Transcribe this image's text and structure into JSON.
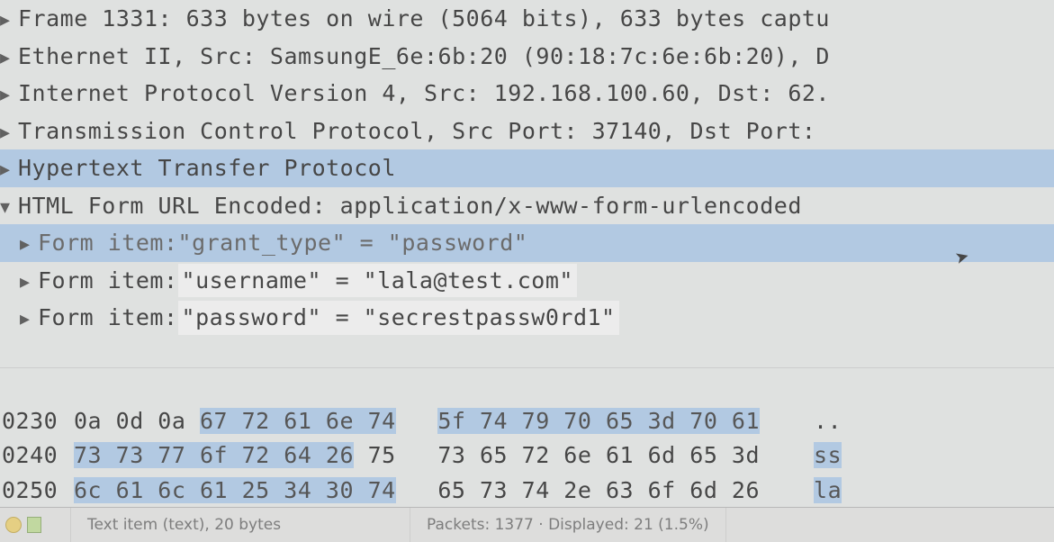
{
  "tree": {
    "frame": "Frame 1331: 633 bytes on wire (5064 bits), 633 bytes captu",
    "ethernet": "Ethernet II, Src: SamsungE_6e:6b:20 (90:18:7c:6e:6b:20), D",
    "ip": "Internet Protocol Version 4, Src: 192.168.100.60, Dst: 62.",
    "tcp": "Transmission Control Protocol, Src Port: 37140, Dst Port: ",
    "http": "Hypertext Transfer Protocol",
    "urlencoded": "HTML Form URL Encoded: application/x-www-form-urlencoded",
    "form_grant_prefix": "Form item: ",
    "form_grant_body": "\"grant_type\" = \"password\"",
    "form_user_prefix": "Form item: ",
    "form_user_body": "\"username\" = \"lala@test.com\"",
    "form_pw_prefix": "Form item: ",
    "form_pw_body": "\"password\" = \"secrestpassw0rd1\""
  },
  "hex": {
    "rows": [
      {
        "offset": "0230",
        "left_plain": "0a 0d 0a ",
        "left_sel": "67 72 61 6e 74",
        "gap": "   ",
        "right_sel": "5f 74 79 70 65 3d 70 61",
        "right_plain": "",
        "ascii": "..",
        "ascii_sel": ""
      },
      {
        "offset": "0240",
        "left_plain": "",
        "left_sel": "73 73 77 6f 72 64 26",
        "gap": " ",
        "right_sel": "",
        "right_plain": "75   73 65 72 6e 61 6d 65 3d",
        "ascii": "",
        "ascii_sel": "ss"
      },
      {
        "offset": "0250",
        "left_plain": "",
        "left_sel": "6c 61 6c 61 25 34 30 74",
        "gap": "   ",
        "right_sel": "",
        "right_plain": "65 73 74 2e 63 6f 6d 26",
        "ascii": "",
        "ascii_sel": "la"
      }
    ]
  },
  "status": {
    "text_item": "Text item (text), 20 bytes",
    "packets": "Packets: 1377 · Displayed: 21 (1.5%)"
  },
  "arrows": {
    "right": "▸",
    "down": "▾"
  }
}
